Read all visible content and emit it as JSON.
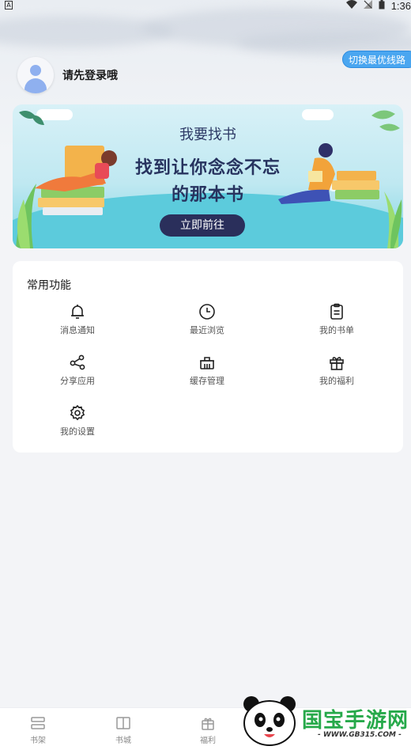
{
  "status_bar": {
    "time": "1:36"
  },
  "header": {
    "switch_route_label": "切换最优线路",
    "login_prompt": "请先登录哦"
  },
  "banner": {
    "title": "我要找书",
    "slogan_line1": "找到让你念念不忘",
    "slogan_line2": "的那本书",
    "cta_label": "立即前往"
  },
  "functions": {
    "title": "常用功能",
    "items": [
      {
        "label": "消息通知",
        "icon": "bell-icon"
      },
      {
        "label": "最近浏览",
        "icon": "clock-icon"
      },
      {
        "label": "我的书单",
        "icon": "clipboard-icon"
      },
      {
        "label": "分享应用",
        "icon": "share-icon"
      },
      {
        "label": "缓存管理",
        "icon": "basket-icon"
      },
      {
        "label": "我的福利",
        "icon": "gift-icon"
      },
      {
        "label": "我的设置",
        "icon": "gear-icon"
      }
    ]
  },
  "bottom_nav": {
    "items": [
      {
        "label": "书架",
        "icon": "bookshelf-icon"
      },
      {
        "label": "书城",
        "icon": "open-book-icon"
      },
      {
        "label": "福利",
        "icon": "gift-box-icon"
      }
    ]
  },
  "watermark": {
    "brand": "国宝手游网",
    "url": "- WWW.GB315.COM -"
  },
  "colors": {
    "accent": "#4aa6f0",
    "cta": "#2a2f5b",
    "brand_green": "#26a94a"
  }
}
